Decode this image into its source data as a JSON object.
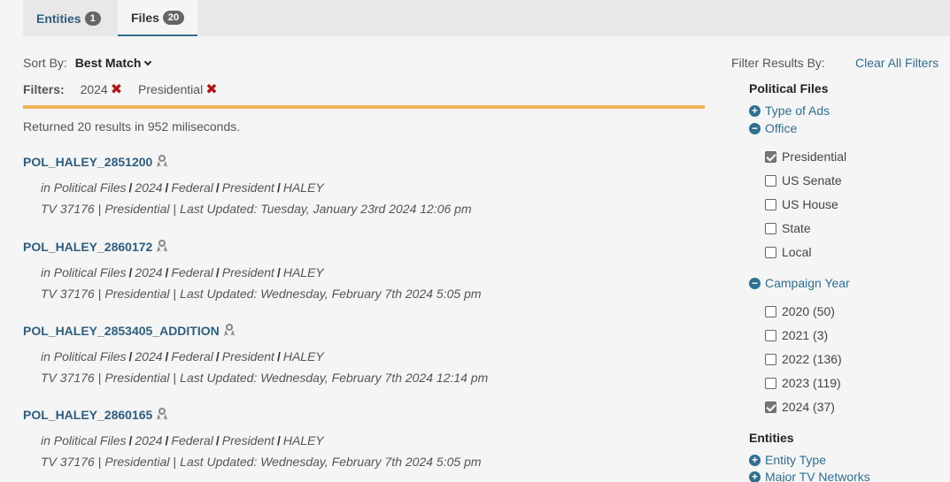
{
  "tabs": [
    {
      "label": "Entities",
      "count": "1"
    },
    {
      "label": "Files",
      "count": "20"
    }
  ],
  "sort": {
    "label": "Sort By:",
    "value": "Best Match"
  },
  "filters": {
    "label": "Filters:",
    "chips": [
      "2024",
      "Presidential"
    ]
  },
  "returned_text": "Returned 20 results in 952 miliseconds.",
  "results": [
    {
      "title": "POL_HALEY_2851200",
      "path": [
        "in Political Files",
        "2024",
        "Federal",
        "President",
        "HALEY"
      ],
      "meta": [
        "TV 37176",
        "Presidential",
        "Last Updated: Tuesday, January 23rd 2024 12:06 pm"
      ]
    },
    {
      "title": "POL_HALEY_2860172",
      "path": [
        "in Political Files",
        "2024",
        "Federal",
        "President",
        "HALEY"
      ],
      "meta": [
        "TV 37176",
        "Presidential",
        "Last Updated: Wednesday, February 7th 2024 5:05 pm"
      ]
    },
    {
      "title": "POL_HALEY_2853405_ADDITION",
      "path": [
        "in Political Files",
        "2024",
        "Federal",
        "President",
        "HALEY"
      ],
      "meta": [
        "TV 37176",
        "Presidential",
        "Last Updated: Wednesday, February 7th 2024 12:14 pm"
      ]
    },
    {
      "title": "POL_HALEY_2860165",
      "path": [
        "in Political Files",
        "2024",
        "Federal",
        "President",
        "HALEY"
      ],
      "meta": [
        "TV 37176",
        "Presidential",
        "Last Updated: Wednesday, February 7th 2024 5:05 pm"
      ]
    }
  ],
  "sidebar": {
    "filter_by": "Filter Results By:",
    "clear_all": "Clear All Filters",
    "political_files": "Political Files",
    "type_of_ads": "Type of Ads",
    "office": "Office",
    "office_options": [
      {
        "label": "Presidential",
        "checked": true
      },
      {
        "label": "US Senate",
        "checked": false
      },
      {
        "label": "US House",
        "checked": false
      },
      {
        "label": "State",
        "checked": false
      },
      {
        "label": "Local",
        "checked": false
      }
    ],
    "campaign_year": "Campaign Year",
    "year_options": [
      {
        "label": "2020 (50)",
        "checked": false
      },
      {
        "label": "2021 (3)",
        "checked": false
      },
      {
        "label": "2022 (136)",
        "checked": false
      },
      {
        "label": "2023 (119)",
        "checked": false
      },
      {
        "label": "2024 (37)",
        "checked": true
      }
    ],
    "entities": "Entities",
    "entity_type": "Entity Type",
    "major_tv_networks": "Major TV Networks"
  },
  "icons": {
    "award": "award-ribbon-icon",
    "remove": "x-mark-icon",
    "expand": "plus-circle-icon",
    "collapse": "minus-circle-icon"
  },
  "colors": {
    "link": "#2f5d7e",
    "accent_bar": "#f0b455",
    "remove_x": "#b01818"
  }
}
